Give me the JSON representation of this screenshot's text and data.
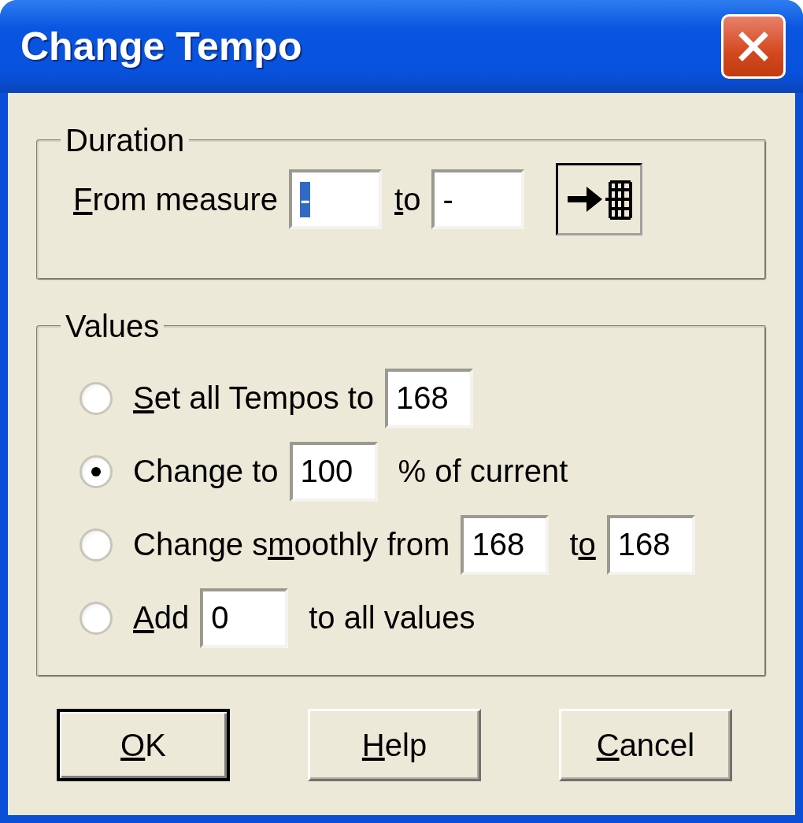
{
  "window": {
    "title": "Change Tempo"
  },
  "duration": {
    "label": "Duration",
    "from": {
      "key": "F",
      "after": "rom measure",
      "value": "-",
      "selected": true
    },
    "to": {
      "key": "t",
      "after": "o",
      "value": "-",
      "selected": false
    }
  },
  "values": {
    "label": "Values",
    "options": [
      {
        "selected": false,
        "parts": [
          {
            "kind": "label",
            "key": "S",
            "after": "et all Tempos to"
          },
          {
            "kind": "field",
            "value": "168"
          }
        ]
      },
      {
        "selected": true,
        "parts": [
          {
            "kind": "label",
            "before": "Change to"
          },
          {
            "kind": "field",
            "value": "100"
          },
          {
            "kind": "label",
            "before": "% of current"
          }
        ]
      },
      {
        "selected": false,
        "parts": [
          {
            "kind": "label",
            "before": "Change s",
            "key": "m",
            "after": "oothly from"
          },
          {
            "kind": "field",
            "value": "168"
          },
          {
            "kind": "label",
            "before": "t",
            "key": "o"
          },
          {
            "kind": "field",
            "value": "168"
          }
        ]
      },
      {
        "selected": false,
        "parts": [
          {
            "kind": "label",
            "key": "A",
            "after": "dd"
          },
          {
            "kind": "field",
            "value": "0"
          },
          {
            "kind": "label",
            "before": "to all values"
          }
        ]
      }
    ]
  },
  "buttons": [
    {
      "key": "O",
      "after": "K",
      "default": true
    },
    {
      "key": "H",
      "after": "elp",
      "default": false
    },
    {
      "key": "C",
      "after": "ancel",
      "default": false
    }
  ]
}
